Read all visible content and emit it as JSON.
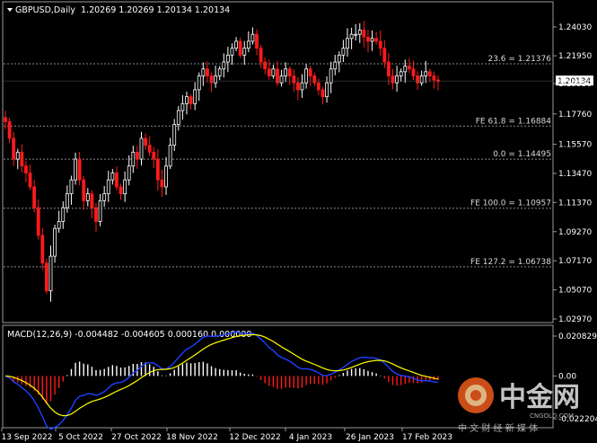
{
  "header": {
    "symbol": "GBPUSD,Daily",
    "ohlc": "1.20269 1.20269 1.20134 1.20134"
  },
  "price_axis": [
    "1.24030",
    "1.21950",
    "1.19950",
    "1.17760",
    "1.15570",
    "1.13470",
    "1.11370",
    "1.09270",
    "1.07170",
    "1.05070",
    "1.02970"
  ],
  "current_price": "1.20134",
  "fib_levels": [
    {
      "label": "23.6 = 1.21376",
      "value": 1.21376
    },
    {
      "label": "FE 61.8 = 1.16884",
      "value": 1.16884
    },
    {
      "label": "0.0 = 1.14495",
      "value": 1.14495
    },
    {
      "label": "FE 100.0 = 1.10957",
      "value": 1.10957
    },
    {
      "label": "FE 127.2 = 1.06738",
      "value": 1.06738
    }
  ],
  "macd": {
    "title": "MACD(12,26,9) -0.004482 -0.004605 0.000160 0.000000",
    "axis": [
      "0.020829",
      "0.00",
      "-0.022204"
    ]
  },
  "date_axis": [
    "13 Sep 2022",
    "5 Oct 2022",
    "27 Oct 2022",
    "18 Nov 2022",
    "12 Dec 2022",
    "4 Jan 2023",
    "26 Jan 2023",
    "17 Feb 2023"
  ],
  "watermark": {
    "brand": "中金网",
    "url": "CNGOLD.COM",
    "tagline": "中 文 财 经 新 媒 体"
  },
  "colors": {
    "bull": "#ffffff",
    "bear": "#ff1a1a",
    "signal": "#ffff00",
    "macd_line": "#1f3fff",
    "grid": "#7a7a7a"
  },
  "chart_data": {
    "type": "candlestick",
    "symbol": "GBPUSD",
    "timeframe": "Daily",
    "ylim": [
      1.0297,
      1.2403
    ],
    "x_ticks": [
      "13 Sep 2022",
      "5 Oct 2022",
      "27 Oct 2022",
      "18 Nov 2022",
      "12 Dec 2022",
      "4 Jan 2023",
      "26 Jan 2023",
      "17 Feb 2023"
    ],
    "closes": [
      1.172,
      1.16,
      1.145,
      1.15,
      1.14,
      1.135,
      1.125,
      1.11,
      1.09,
      1.07,
      1.05,
      1.075,
      1.095,
      1.1,
      1.11,
      1.12,
      1.13,
      1.145,
      1.13,
      1.115,
      1.12,
      1.11,
      1.1,
      1.115,
      1.12,
      1.13,
      1.135,
      1.125,
      1.12,
      1.13,
      1.14,
      1.15,
      1.145,
      1.16,
      1.155,
      1.15,
      1.145,
      1.13,
      1.125,
      1.14,
      1.155,
      1.17,
      1.18,
      1.185,
      1.19,
      1.185,
      1.195,
      1.205,
      1.21,
      1.205,
      1.2,
      1.205,
      1.21,
      1.215,
      1.22,
      1.225,
      1.23,
      1.22,
      1.225,
      1.23,
      1.235,
      1.225,
      1.215,
      1.21,
      1.205,
      1.21,
      1.2,
      1.205,
      1.21,
      1.205,
      1.2,
      1.195,
      1.2,
      1.21,
      1.205,
      1.2,
      1.195,
      1.19,
      1.2,
      1.21,
      1.215,
      1.22,
      1.225,
      1.232,
      1.235,
      1.235,
      1.238,
      1.233,
      1.23,
      1.232,
      1.23,
      1.225,
      1.215,
      1.205,
      1.2,
      1.205,
      1.208,
      1.212,
      1.21,
      1.205,
      1.2,
      1.205,
      1.208,
      1.205,
      1.202,
      1.201
    ],
    "current": 1.20134,
    "fib_levels": [
      1.21376,
      1.16884,
      1.14495,
      1.10957,
      1.06738
    ],
    "macd_params": [
      12,
      26,
      9
    ],
    "macd_ylim": [
      -0.022204,
      0.020829
    ]
  }
}
